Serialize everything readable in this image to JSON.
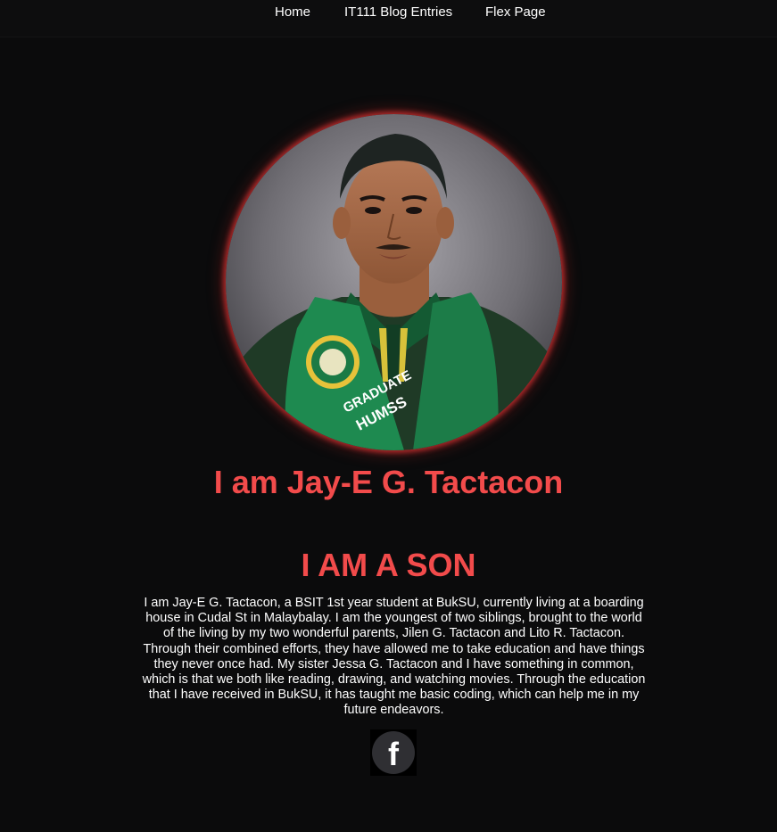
{
  "nav": {
    "items": [
      {
        "label": "Home"
      },
      {
        "label": "IT111 Blog Entries"
      },
      {
        "label": "Flex Page"
      }
    ]
  },
  "profile": {
    "photo_badge_text_1": "GRADUATE",
    "photo_badge_text_2": "HUMSS",
    "name_heading": "I am Jay-E G. Tactacon"
  },
  "section": {
    "heading": "I AM A SON",
    "paragraph": "I am Jay-E G. Tactacon, a BSIT 1st year student at BukSU, currently living at a boarding house in Cudal St in Malaybalay. I am the youngest of two siblings, brought to the world of the living by my two wonderful parents, Jilen G. Tactacon and Lito R. Tactacon. Through their combined efforts, they have allowed me to take education and have things they never once had. My sister Jessa G. Tactacon and I have something in common, which is that we both like reading, drawing, and watching movies. Through the education that I have received in BukSU, it has taught me basic coding, which can help me in my future endeavors."
  },
  "social": {
    "icon": "facebook-icon",
    "glyph": "f"
  },
  "colors": {
    "accent": "#f24b4b",
    "background": "#0b0b0c",
    "glow": "#d23030"
  }
}
